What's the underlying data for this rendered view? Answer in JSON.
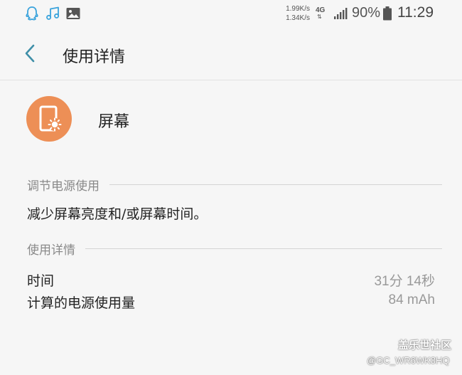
{
  "status_bar": {
    "notification_icons": [
      "qq-icon",
      "music-note-icon",
      "image-icon"
    ],
    "net_speed_down": "1.99K/s",
    "net_speed_up": "1.34K/s",
    "network_type": "4G",
    "battery_percent": "90%",
    "time": "11:29"
  },
  "header": {
    "title": "使用详情"
  },
  "app": {
    "name": "屏幕",
    "icon_color": "#ed8f56"
  },
  "power_section": {
    "title": "调节电源使用",
    "tip": "减少屏幕亮度和/或屏幕时间。"
  },
  "detail_section": {
    "title": "使用详情",
    "rows": [
      {
        "label": "时间",
        "value": "31分 14秒"
      },
      {
        "label": "计算的电源使用量",
        "value": "84 mAh"
      }
    ]
  },
  "watermark": {
    "title": "盖乐世社区",
    "user": "@GC_WR6WK8HQ"
  }
}
